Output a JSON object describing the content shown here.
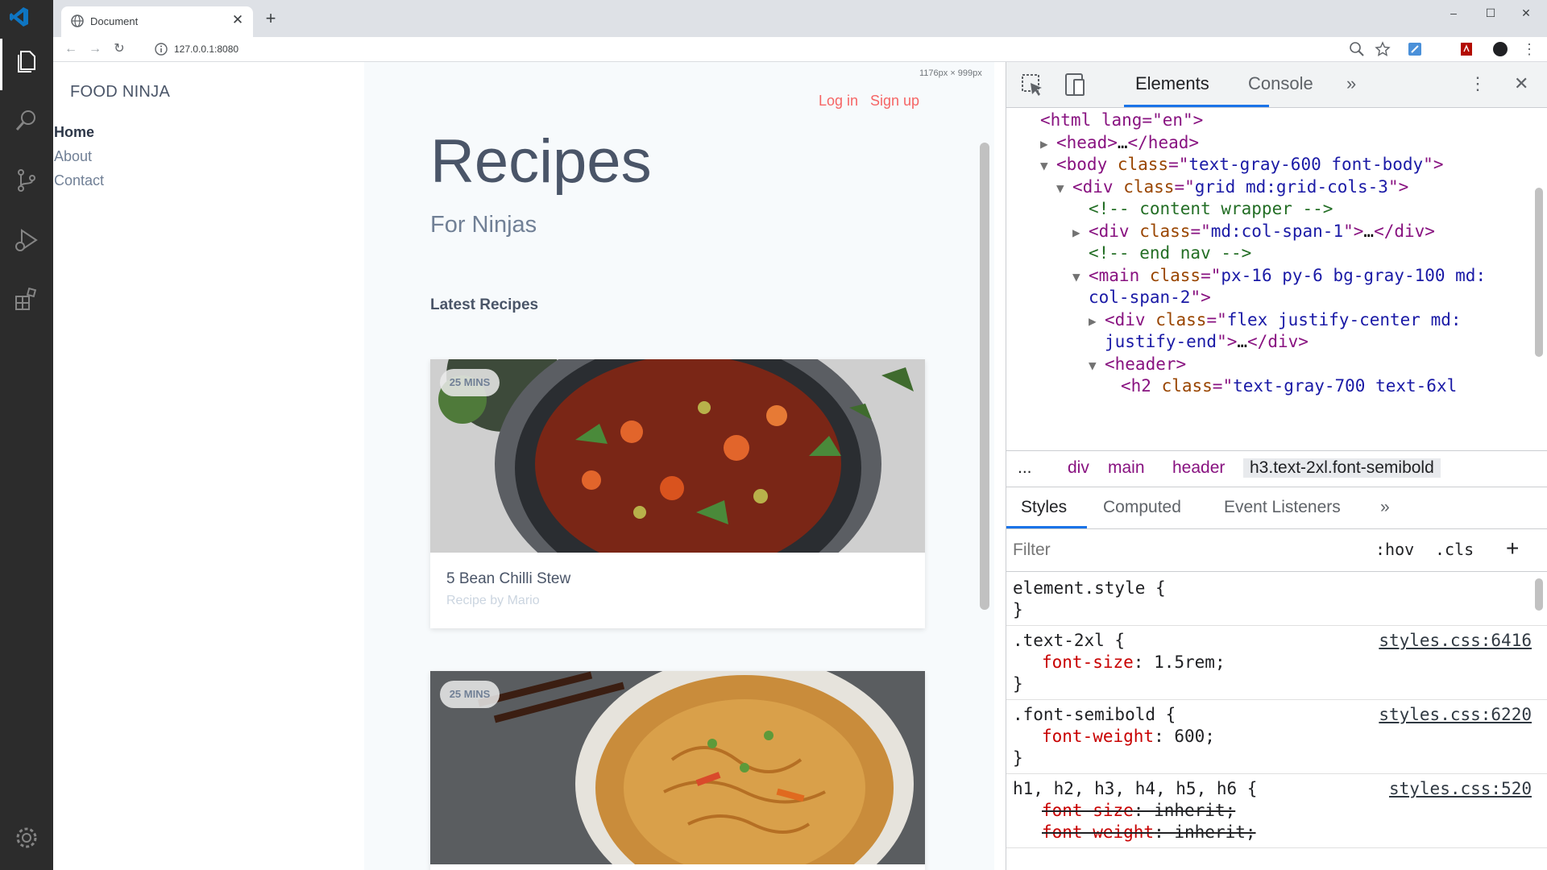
{
  "browser": {
    "tab_title": "Document",
    "tab_close": "✕",
    "new_tab": "+",
    "url": "127.0.0.1:8080",
    "window_controls": [
      "–",
      "☐",
      "✕"
    ],
    "viewport_size_label": "1176px × 999px"
  },
  "site": {
    "brand": "FOOD NINJA",
    "nav_links": [
      "Home",
      "About",
      "Contact"
    ],
    "auth": {
      "login": "Log in",
      "signup": "Sign up"
    },
    "title": "Recipes",
    "subtitle": "For Ninjas",
    "section_heading": "Latest Recipes",
    "recipes": [
      {
        "time": "25 MINS",
        "name": "5 Bean Chilli Stew",
        "author": "Recipe by Mario"
      },
      {
        "time": "25 MINS",
        "name": "",
        "author": ""
      }
    ],
    "colors": {
      "accent": "#f56565",
      "text": "#4a5568",
      "bg_main": "#f7fafc"
    }
  },
  "devtools": {
    "tabs": [
      "Elements",
      "Console"
    ],
    "more_tabs": "»",
    "dom_lines": [
      {
        "indent": 0,
        "tri": "",
        "parts": [
          [
            "tag",
            "<html lang=\"en\">"
          ]
        ]
      },
      {
        "indent": 1,
        "tri": "▶",
        "parts": [
          [
            "tag",
            "<head>"
          ],
          [
            "plain",
            "…"
          ],
          [
            "tag",
            "</head>"
          ]
        ]
      },
      {
        "indent": 1,
        "tri": "▼",
        "parts": [
          [
            "tag",
            "<body "
          ],
          [
            "attr",
            "class"
          ],
          [
            "tag",
            "=\""
          ],
          [
            "val",
            "text-gray-600 font-body"
          ],
          [
            "tag",
            "\">"
          ]
        ]
      },
      {
        "indent": 2,
        "tri": "▼",
        "parts": [
          [
            "tag",
            "<div "
          ],
          [
            "attr",
            "class"
          ],
          [
            "tag",
            "=\""
          ],
          [
            "val",
            "grid md:grid-cols-3"
          ],
          [
            "tag",
            "\">"
          ]
        ]
      },
      {
        "indent": 3,
        "tri": "",
        "parts": [
          [
            "cmt",
            "<!-- content wrapper -->"
          ]
        ]
      },
      {
        "indent": 3,
        "tri": "▶",
        "parts": [
          [
            "tag",
            "<div "
          ],
          [
            "attr",
            "class"
          ],
          [
            "tag",
            "=\""
          ],
          [
            "val",
            "md:col-span-1"
          ],
          [
            "tag",
            "\">"
          ],
          [
            "plain",
            "…"
          ],
          [
            "tag",
            "</div>"
          ]
        ]
      },
      {
        "indent": 3,
        "tri": "",
        "parts": [
          [
            "cmt",
            "<!-- end nav -->"
          ]
        ]
      },
      {
        "indent": 3,
        "tri": "▼",
        "parts": [
          [
            "tag",
            "<main "
          ],
          [
            "attr",
            "class"
          ],
          [
            "tag",
            "=\""
          ],
          [
            "val",
            "px-16 py-6 bg-gray-100 md:"
          ]
        ]
      },
      {
        "indent": 3,
        "tri": "",
        "parts": [
          [
            "val",
            "col-span-2"
          ],
          [
            "tag",
            "\">"
          ]
        ]
      },
      {
        "indent": 4,
        "tri": "▶",
        "parts": [
          [
            "tag",
            "<div "
          ],
          [
            "attr",
            "class"
          ],
          [
            "tag",
            "=\""
          ],
          [
            "val",
            "flex justify-center md:"
          ]
        ]
      },
      {
        "indent": 4,
        "tri": "",
        "parts": [
          [
            "val",
            "justify-end"
          ],
          [
            "tag",
            "\">"
          ],
          [
            "plain",
            "…"
          ],
          [
            "tag",
            "</div>"
          ]
        ]
      },
      {
        "indent": 4,
        "tri": "▼",
        "parts": [
          [
            "tag",
            "<header>"
          ]
        ]
      },
      {
        "indent": 5,
        "tri": "",
        "parts": [
          [
            "tag",
            "<h2 "
          ],
          [
            "attr",
            "class"
          ],
          [
            "tag",
            "=\""
          ],
          [
            "val",
            "text-gray-700 text-6xl"
          ]
        ]
      }
    ],
    "breadcrumbs": [
      "...",
      "div",
      "main",
      "header",
      "h3.text-2xl.font-semibold"
    ],
    "style_tabs": [
      "Styles",
      "Computed",
      "Event Listeners"
    ],
    "filter_placeholder": "Filter",
    "hov": ":hov",
    "cls": ".cls",
    "add_rule": "+",
    "rules": [
      {
        "selector": "element.style {",
        "props": [],
        "source": "",
        "close": "}"
      },
      {
        "selector": ".text-2xl {",
        "props": [
          [
            "font-size",
            "1.5rem;",
            false
          ]
        ],
        "source": "styles.css:6416",
        "close": "}"
      },
      {
        "selector": ".font-semibold {",
        "props": [
          [
            "font-weight",
            "600;",
            false
          ]
        ],
        "source": "styles.css:6220",
        "close": "}"
      },
      {
        "selector": "h1, h2, h3, h4, h5, h6 {",
        "props": [
          [
            "font-size",
            "inherit;",
            true
          ],
          [
            "font-weight",
            "inherit;",
            true
          ]
        ],
        "source": "styles.css:520",
        "close": ""
      }
    ]
  }
}
